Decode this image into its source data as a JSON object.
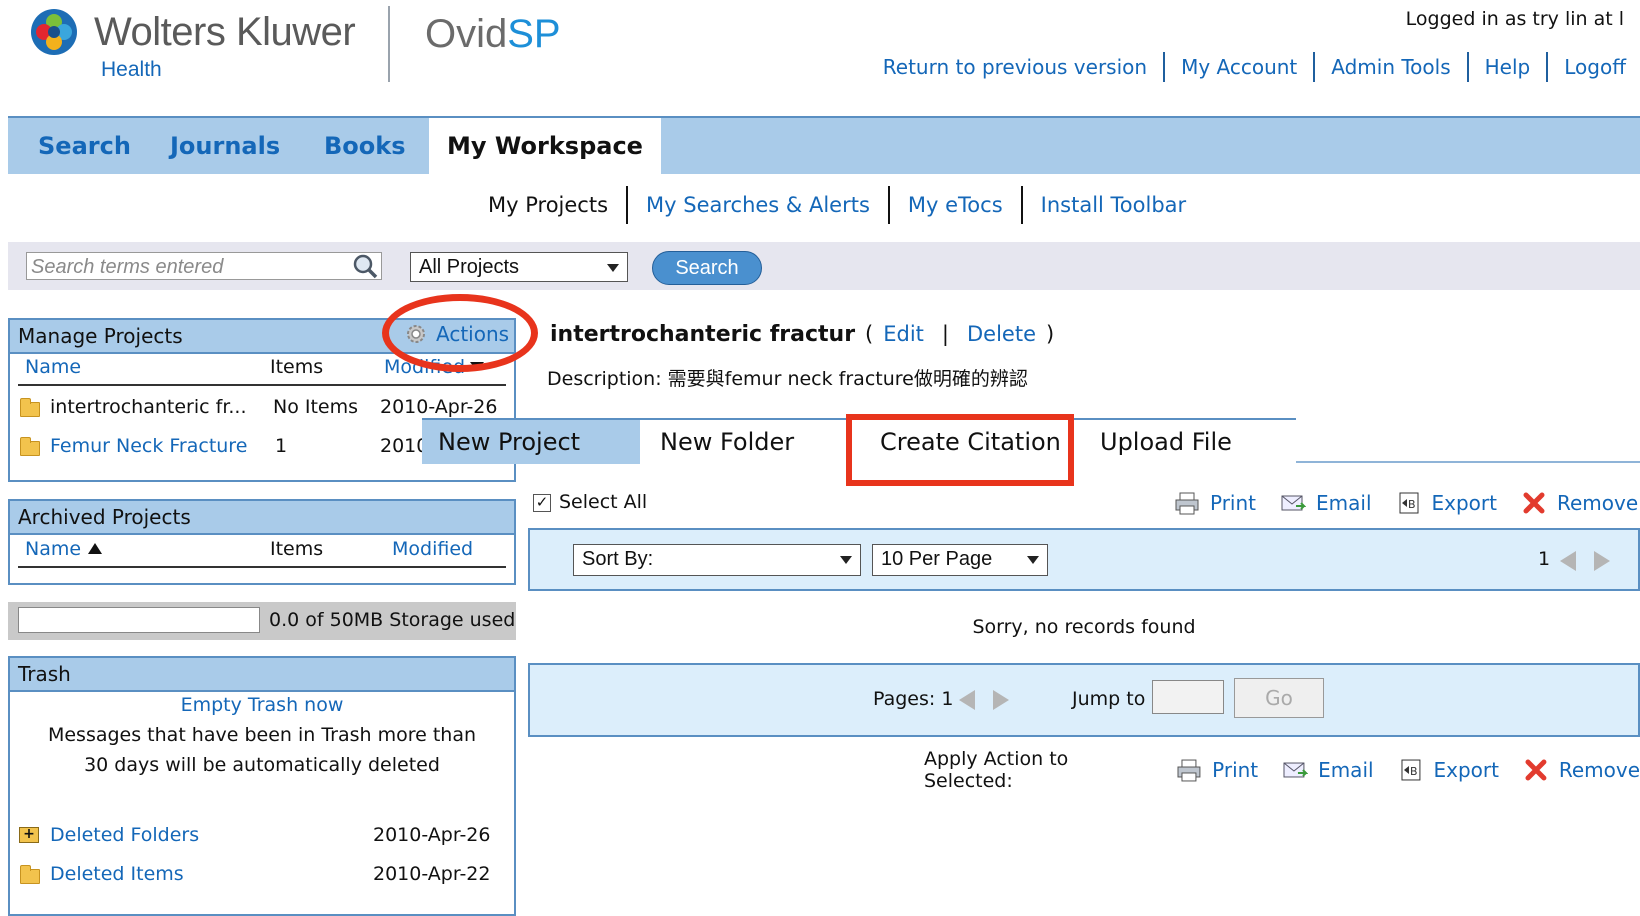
{
  "header": {
    "brand": "Wolters Kluwer",
    "brand_sub": "Health",
    "product_a": "Ovid",
    "product_b": "SP",
    "logged_in": "Logged in as try lin at l",
    "links": [
      "Return to previous version",
      "My Account",
      "Admin Tools",
      "Help",
      "Logoff"
    ]
  },
  "nav": {
    "tabs": [
      {
        "label": "Search",
        "active": false
      },
      {
        "label": "Journals",
        "active": false
      },
      {
        "label": "Books",
        "active": false
      },
      {
        "label": "My Workspace",
        "active": true
      }
    ],
    "subtabs": [
      "My Projects",
      "My Searches & Alerts",
      "My eTocs",
      "Install Toolbar"
    ]
  },
  "searchbar": {
    "placeholder": "Search terms entered",
    "scope": "All Projects",
    "button": "Search"
  },
  "manage": {
    "title": "Manage Projects",
    "actions": "Actions",
    "col_name": "Name",
    "col_items": "Items",
    "col_modified": "Modified",
    "rows": [
      {
        "name": "intertrochanteric fr...",
        "items": "No Items",
        "modified": "2010-Apr-26"
      },
      {
        "name": "Femur Neck Fracture",
        "items": "1",
        "modified": "2010-"
      }
    ]
  },
  "archived": {
    "title": "Archived Projects",
    "col_name": "Name",
    "col_items": "Items",
    "col_modified": "Modified"
  },
  "storage": {
    "label": "0.0 of 50MB Storage used",
    "used_fraction": 0
  },
  "trash": {
    "title": "Trash",
    "empty_link": "Empty Trash now",
    "message_1": "Messages that have been in Trash more than",
    "message_2": "30 days will be automatically deleted",
    "items": [
      {
        "name": "Deleted Folders",
        "date": "2010-Apr-26"
      },
      {
        "name": "Deleted Items",
        "date": "2010-Apr-22"
      }
    ]
  },
  "project": {
    "title": "intertrochanteric fractur",
    "paren_open": "(",
    "edit": "Edit",
    "sep": "|",
    "delete": "Delete",
    "paren_close": ")",
    "description_label": "Description:",
    "description": "需要與femur neck fracture做明確的辨認"
  },
  "action_menu": [
    "New Project",
    "New Folder",
    "Create Citation",
    "Upload File"
  ],
  "toolbar": {
    "select_all": "Select All",
    "print": "Print",
    "email": "Email",
    "export": "Export",
    "remove": "Remove",
    "sort_by": "Sort By:",
    "per_page": "10 Per Page",
    "page_num": "1"
  },
  "results": {
    "empty": "Sorry, no records found",
    "pages_label": "Pages: 1",
    "jump_label": "Jump to",
    "go": "Go",
    "apply_label": "Apply Action to Selected:"
  },
  "colors": {
    "link": "#1467b8",
    "nav_bg": "#a9cbe9",
    "annotation": "#e8341c"
  }
}
